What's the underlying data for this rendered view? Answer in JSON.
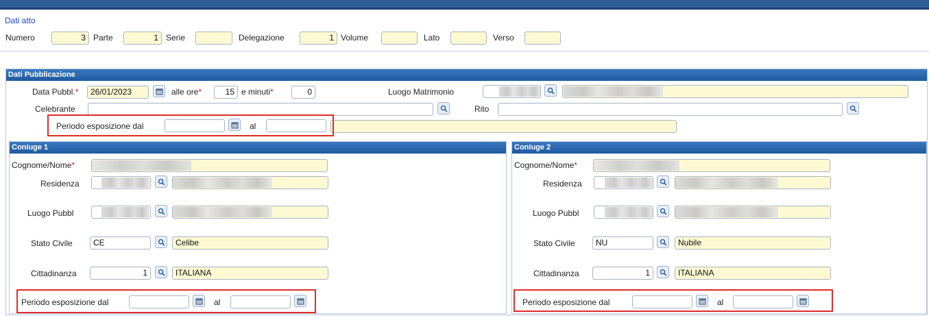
{
  "dati_atto": {
    "title": "Dati atto",
    "numero_label": "Numero",
    "numero_value": "3",
    "parte_label": "Parte",
    "parte_value": "1",
    "serie_label": "Serie",
    "serie_value": "",
    "delegazione_label": "Delegazione",
    "delegazione_value": "1",
    "volume_label": "Volume",
    "volume_value": "",
    "lato_label": "Lato",
    "lato_value": "",
    "verso_label": "Verso",
    "verso_value": ""
  },
  "pubblicazione": {
    "title": "Dati Pubblicazione",
    "data_label": "Data Pubbl.",
    "data_value": "26/01/2023",
    "ore_label": "alle ore",
    "ore_value": "15",
    "minuti_label": "e minuti",
    "minuti_value": "0",
    "luogo_label": "Luogo Matrimonio",
    "celebrante_label": "Celebrante",
    "rito_label": "Rito",
    "periodo_label": "Periodo esposizione dal",
    "al_label": "al"
  },
  "coniuge1": {
    "title": "Coniuge 1",
    "cognome_label": "Cognome/Nome",
    "residenza_label": "Residenza",
    "luogo_pubbl_label": "Luogo Pubbl",
    "stato_civile_label": "Stato Civile",
    "stato_code": "CE",
    "stato_desc": "Celibe",
    "cittadinanza_label": "Cittadinanza",
    "citt_code": "1",
    "citt_desc": "ITALIANA",
    "periodo_label": "Periodo esposizione dal",
    "al_label": "al"
  },
  "coniuge2": {
    "title": "Coniuge 2",
    "cognome_label": "Cognome/Nome",
    "residenza_label": "Residenza",
    "luogo_pubbl_label": "Luogo Pubbl",
    "stato_civile_label": "Stato Civile",
    "stato_code": "NU",
    "stato_desc": "Nubile",
    "cittadinanza_label": "Cittadinanza",
    "citt_code": "1",
    "citt_desc": "ITALIANA",
    "periodo_label": "Periodo esposizione dal",
    "al_label": "al"
  },
  "icons": {
    "search": "search-icon",
    "calendar": "calendar-icon"
  },
  "colors": {
    "header_blue": "#1f5aa0",
    "field_yellow": "#fdfad3",
    "highlight_red": "#e02b2b"
  }
}
